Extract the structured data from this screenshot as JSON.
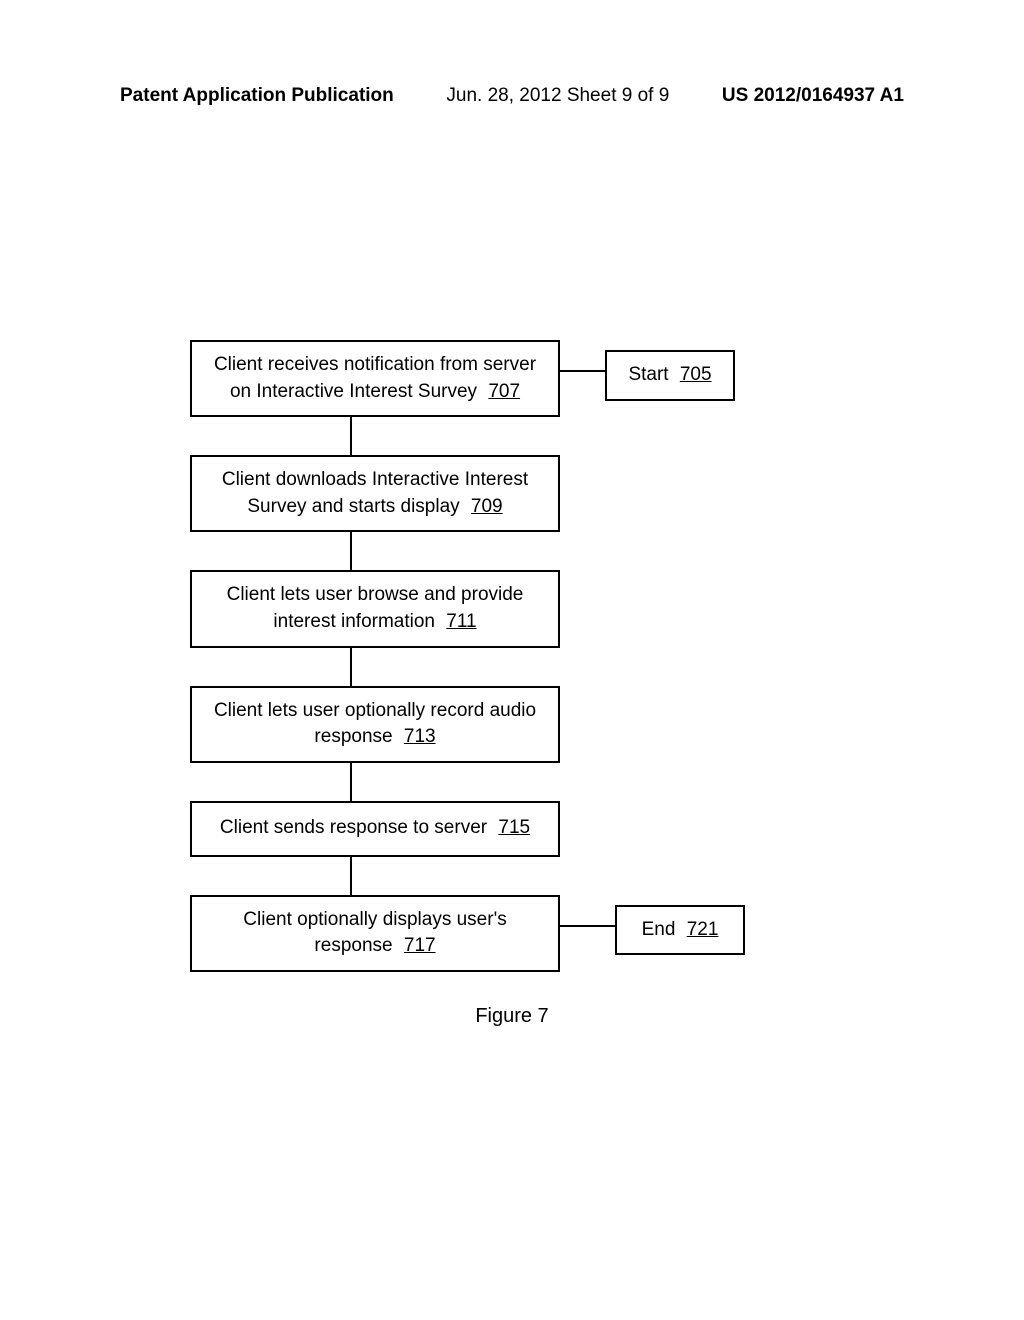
{
  "header": {
    "left": "Patent Application Publication",
    "center": "Jun. 28, 2012  Sheet 9 of 9",
    "right": "US 2012/0164937 A1"
  },
  "flowchart": {
    "steps": [
      {
        "text": "Client receives notification from server on Interactive Interest Survey",
        "ref": "707"
      },
      {
        "text": "Client downloads Interactive Interest Survey and starts display",
        "ref": "709"
      },
      {
        "text": "Client lets user browse and provide interest information",
        "ref": "711"
      },
      {
        "text": "Client lets user optionally record audio response",
        "ref": "713"
      },
      {
        "text": "Client sends response to server",
        "ref": "715"
      },
      {
        "text": "Client optionally displays user's response",
        "ref": "717"
      }
    ],
    "start": {
      "label": "Start",
      "ref": "705"
    },
    "end": {
      "label": "End",
      "ref": "721"
    }
  },
  "caption": "Figure 7"
}
